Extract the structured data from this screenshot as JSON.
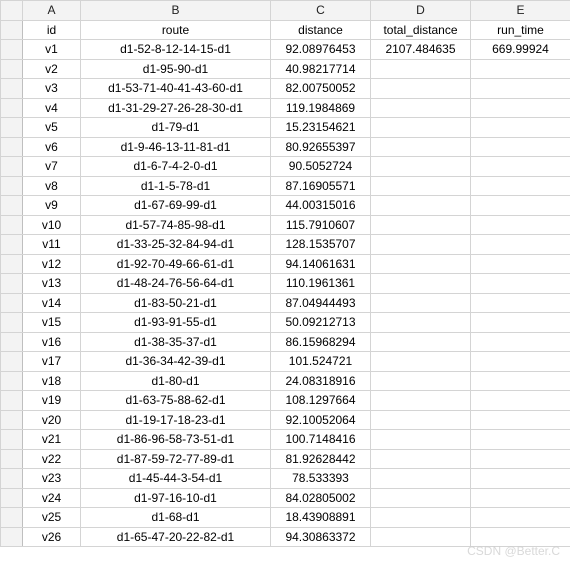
{
  "columns": {
    "A": "A",
    "B": "B",
    "C": "C",
    "D": "D",
    "E": "E"
  },
  "headers": {
    "id": "id",
    "route": "route",
    "distance": "distance",
    "total_distance": "total_distance",
    "run_time": "run_time"
  },
  "summary": {
    "total_distance": "2107.484635",
    "run_time": "669.99924"
  },
  "rows": [
    {
      "id": "v1",
      "route": "d1-52-8-12-14-15-d1",
      "distance": "92.08976453"
    },
    {
      "id": "v2",
      "route": "d1-95-90-d1",
      "distance": "40.98217714"
    },
    {
      "id": "v3",
      "route": "d1-53-71-40-41-43-60-d1",
      "distance": "82.00750052"
    },
    {
      "id": "v4",
      "route": "d1-31-29-27-26-28-30-d1",
      "distance": "119.1984869"
    },
    {
      "id": "v5",
      "route": "d1-79-d1",
      "distance": "15.23154621"
    },
    {
      "id": "v6",
      "route": "d1-9-46-13-11-81-d1",
      "distance": "80.92655397"
    },
    {
      "id": "v7",
      "route": "d1-6-7-4-2-0-d1",
      "distance": "90.5052724"
    },
    {
      "id": "v8",
      "route": "d1-1-5-78-d1",
      "distance": "87.16905571"
    },
    {
      "id": "v9",
      "route": "d1-67-69-99-d1",
      "distance": "44.00315016"
    },
    {
      "id": "v10",
      "route": "d1-57-74-85-98-d1",
      "distance": "115.7910607"
    },
    {
      "id": "v11",
      "route": "d1-33-25-32-84-94-d1",
      "distance": "128.1535707"
    },
    {
      "id": "v12",
      "route": "d1-92-70-49-66-61-d1",
      "distance": "94.14061631"
    },
    {
      "id": "v13",
      "route": "d1-48-24-76-56-64-d1",
      "distance": "110.1961361"
    },
    {
      "id": "v14",
      "route": "d1-83-50-21-d1",
      "distance": "87.04944493"
    },
    {
      "id": "v15",
      "route": "d1-93-91-55-d1",
      "distance": "50.09212713"
    },
    {
      "id": "v16",
      "route": "d1-38-35-37-d1",
      "distance": "86.15968294"
    },
    {
      "id": "v17",
      "route": "d1-36-34-42-39-d1",
      "distance": "101.524721"
    },
    {
      "id": "v18",
      "route": "d1-80-d1",
      "distance": "24.08318916"
    },
    {
      "id": "v19",
      "route": "d1-63-75-88-62-d1",
      "distance": "108.1297664"
    },
    {
      "id": "v20",
      "route": "d1-19-17-18-23-d1",
      "distance": "92.10052064"
    },
    {
      "id": "v21",
      "route": "d1-86-96-58-73-51-d1",
      "distance": "100.7148416"
    },
    {
      "id": "v22",
      "route": "d1-87-59-72-77-89-d1",
      "distance": "81.92628442"
    },
    {
      "id": "v23",
      "route": "d1-45-44-3-54-d1",
      "distance": "78.533393"
    },
    {
      "id": "v24",
      "route": "d1-97-16-10-d1",
      "distance": "84.02805002"
    },
    {
      "id": "v25",
      "route": "d1-68-d1",
      "distance": "18.43908891"
    },
    {
      "id": "v26",
      "route": "d1-65-47-20-22-82-d1",
      "distance": "94.30863372"
    }
  ],
  "watermark": "CSDN @Better.C"
}
